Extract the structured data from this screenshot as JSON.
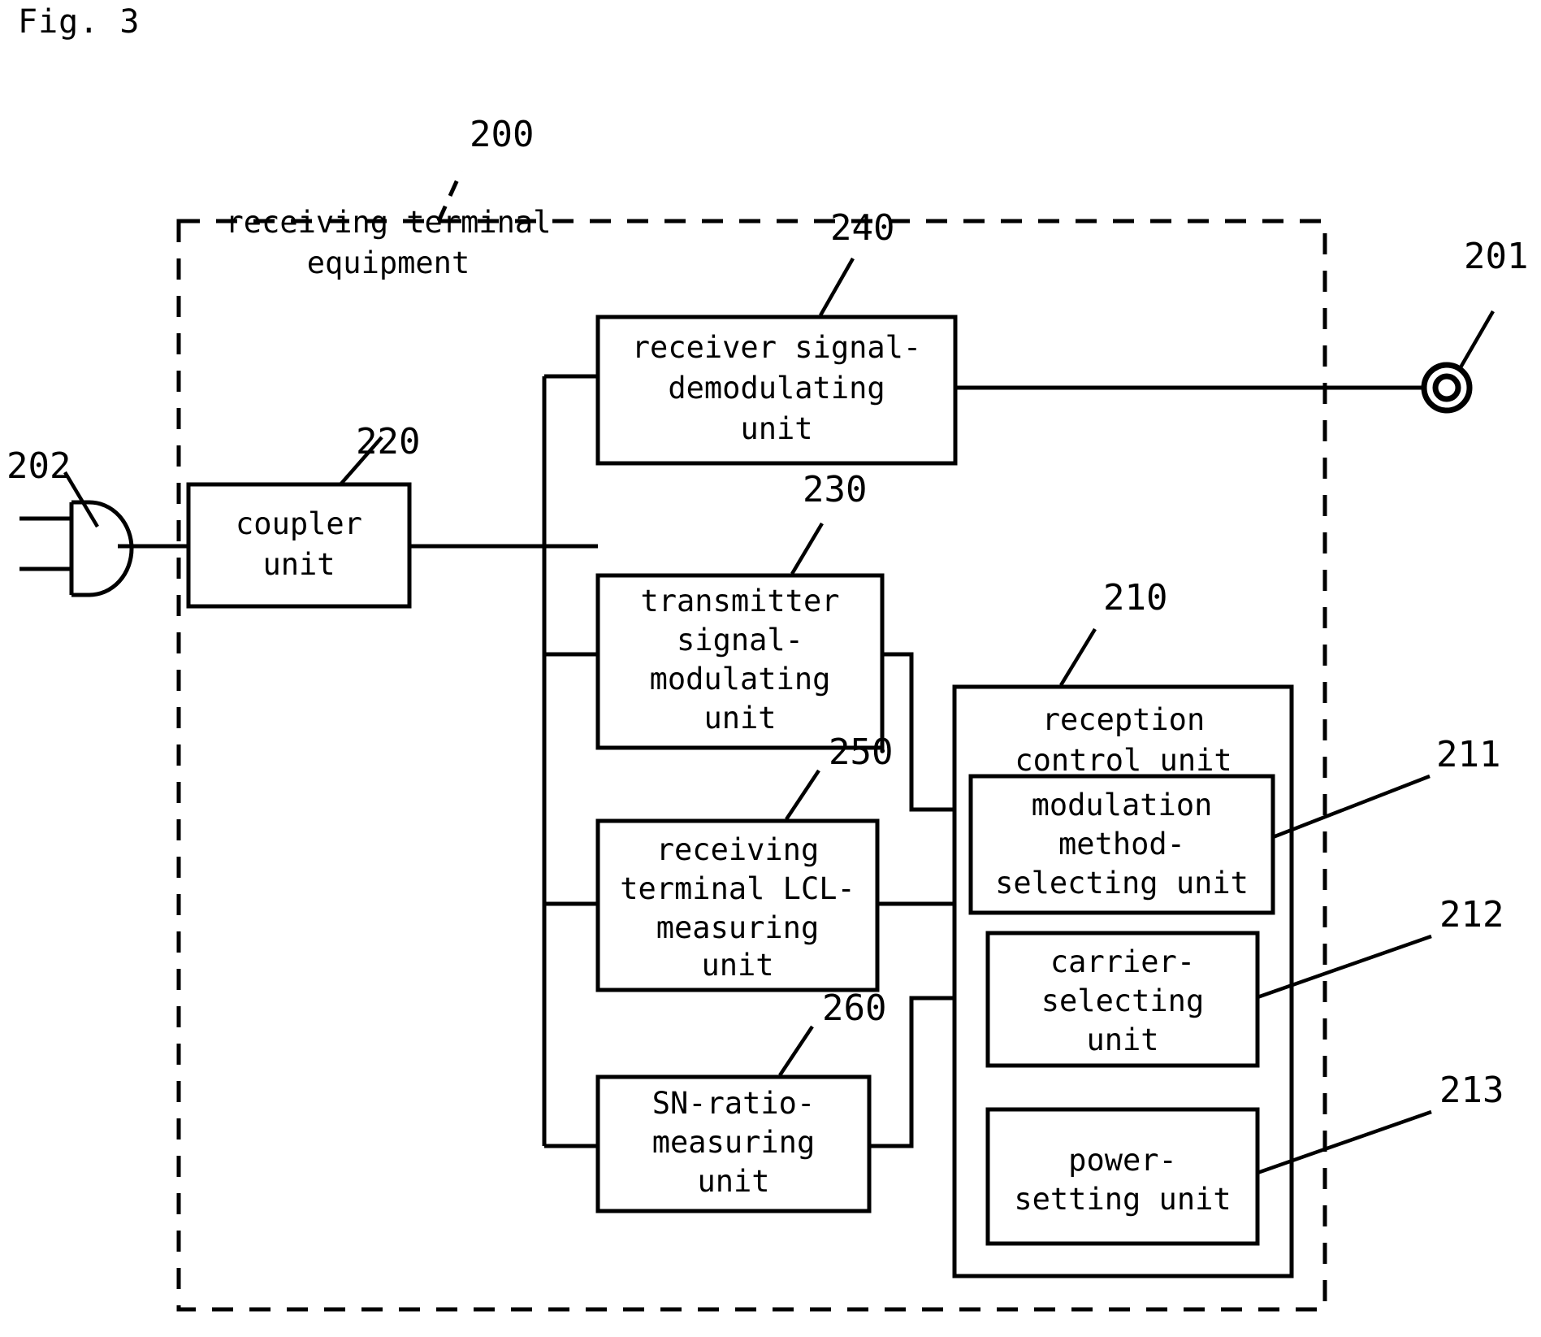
{
  "figure": {
    "label": "Fig. 3",
    "type": "patent-block-diagram"
  },
  "enclosure": {
    "ref": "200",
    "title_line1": "receiving terminal",
    "title_line2": "equipment"
  },
  "terminals": [
    {
      "ref": "201",
      "name": "line-terminal",
      "shape": "double-circle"
    },
    {
      "ref": "202",
      "name": "plug-connector",
      "shape": "plug"
    }
  ],
  "blocks": [
    {
      "ref": "240",
      "name": "receiver-signal-demodulating-unit",
      "lines": [
        "receiver signal-",
        "demodulating",
        "unit"
      ]
    },
    {
      "ref": "220",
      "name": "coupler-unit",
      "lines": [
        "coupler",
        "unit"
      ]
    },
    {
      "ref": "230",
      "name": "transmitter-signal-modulating-unit",
      "lines": [
        "transmitter",
        "signal-",
        "modulating",
        "unit"
      ]
    },
    {
      "ref": "250",
      "name": "receiving-terminal-lcl-measuring-unit",
      "lines": [
        "receiving",
        "terminal LCL-",
        "measuring",
        "unit"
      ]
    },
    {
      "ref": "260",
      "name": "sn-ratio-measuring-unit",
      "lines": [
        "SN-ratio-",
        "measuring",
        "unit"
      ]
    },
    {
      "ref": "210",
      "name": "reception-control-unit",
      "lines": [
        "reception",
        "control unit"
      ]
    },
    {
      "ref": "211",
      "name": "modulation-method-selecting-unit",
      "lines": [
        "modulation",
        "method-",
        "selecting unit"
      ]
    },
    {
      "ref": "212",
      "name": "carrier-selecting-unit",
      "lines": [
        "carrier-",
        "selecting",
        "unit"
      ]
    },
    {
      "ref": "213",
      "name": "power-setting-unit",
      "lines": [
        "power-",
        "setting unit"
      ]
    }
  ],
  "colors": {
    "ink": "#000000",
    "paper": "#ffffff"
  }
}
